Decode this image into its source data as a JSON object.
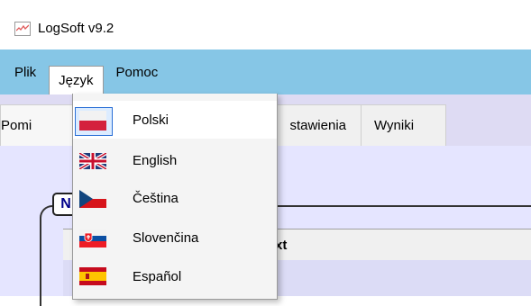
{
  "window": {
    "title": "LogSoft v9.2"
  },
  "menubar": {
    "items": [
      {
        "label": "Plik"
      },
      {
        "label": "Język"
      },
      {
        "label": "Pomoc"
      }
    ]
  },
  "tabs": {
    "items": [
      {
        "label": "Pomi"
      },
      {
        "label": "stawienia"
      },
      {
        "label": "Wyniki"
      }
    ]
  },
  "groupbox": {
    "label": "N"
  },
  "table": {
    "header_fragment": "xt"
  },
  "language_menu": {
    "items": [
      {
        "label": "Polski",
        "flag": "poland-flag-icon",
        "selected": true
      },
      {
        "label": "English",
        "flag": "uk-flag-icon",
        "selected": false
      },
      {
        "label": "Čeština",
        "flag": "czech-flag-icon",
        "selected": false
      },
      {
        "label": "Slovenčina",
        "flag": "slovakia-flag-icon",
        "selected": false
      },
      {
        "label": "Español",
        "flag": "spain-flag-icon",
        "selected": false
      }
    ]
  },
  "colors": {
    "menubar_bg": "#86c6e6",
    "tab_area_bg": "#dedbf3",
    "content_bg": "#e5e5ff",
    "check_frame": "#2a6fd6"
  }
}
